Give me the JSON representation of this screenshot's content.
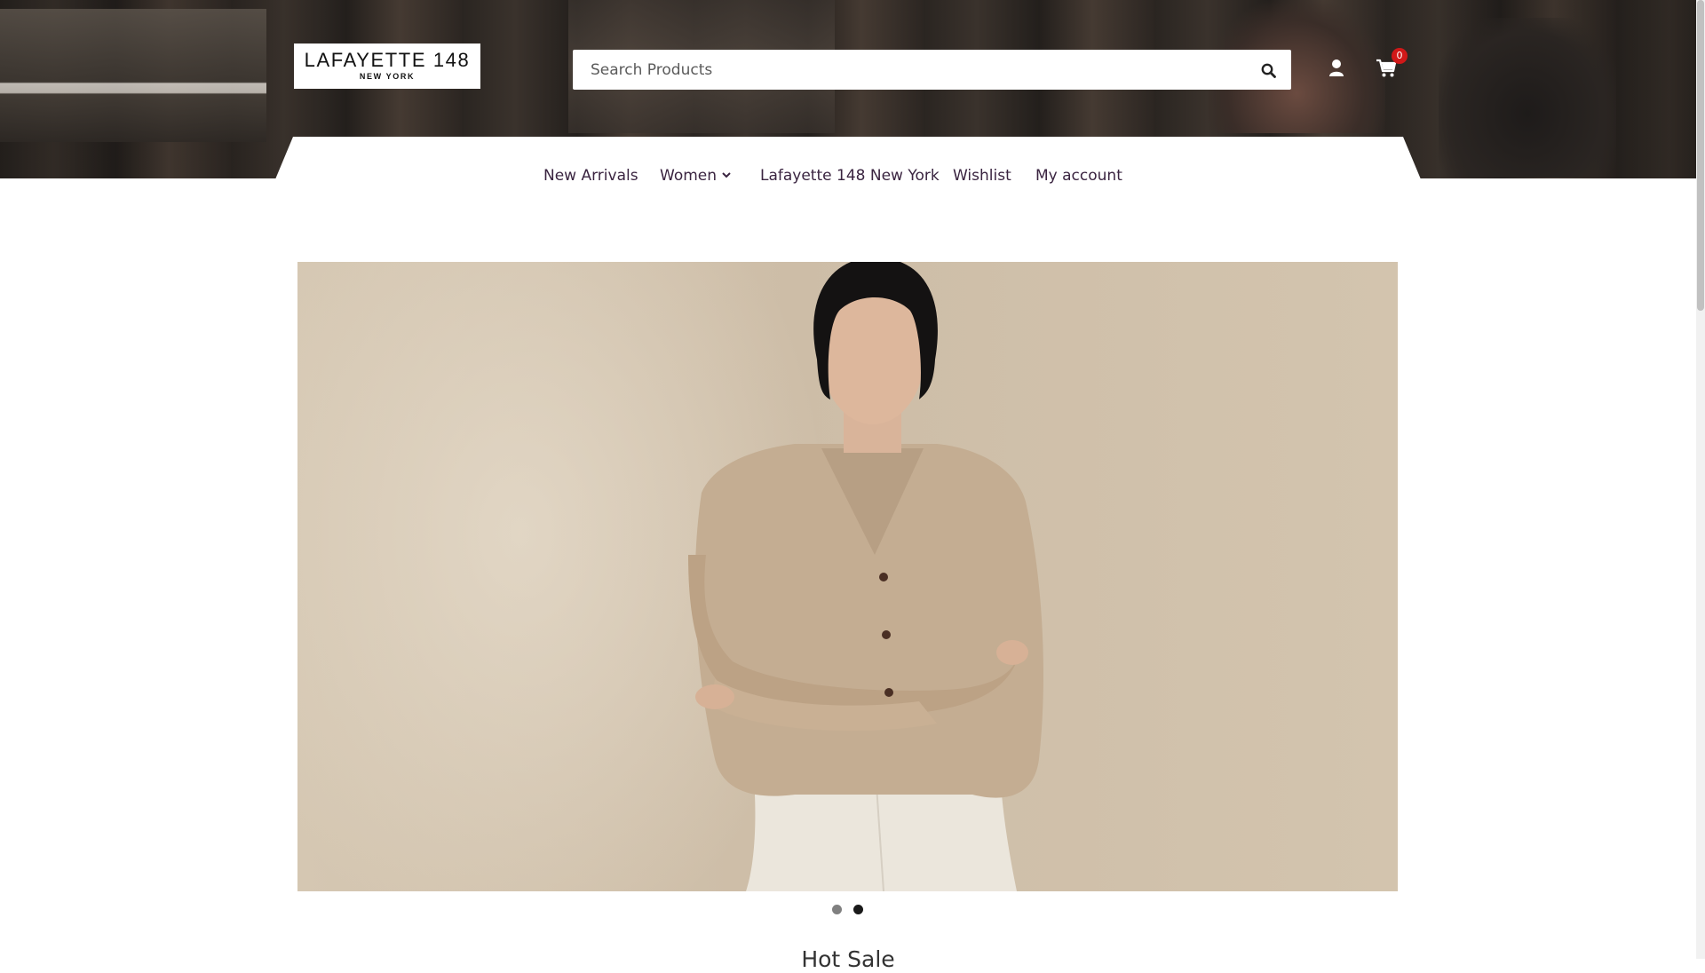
{
  "brand": {
    "logo_main": "LAFAYETTE 148",
    "logo_sub": "NEW YORK"
  },
  "search": {
    "placeholder": "Search Products",
    "button_icon": "search-icon"
  },
  "header_icons": {
    "account_icon": "user-icon",
    "cart_icon": "shopping-cart-icon",
    "cart_count": "0"
  },
  "nav": {
    "items": [
      {
        "label": "New Arrivals"
      },
      {
        "label": "Women",
        "has_dropdown": true
      },
      {
        "label": "Lafayette 148 New York"
      },
      {
        "label": "Wishlist"
      },
      {
        "label": "My account"
      }
    ]
  },
  "hero": {
    "slide_count": 2,
    "active_slide": 2
  },
  "sections": {
    "hot_sale_title": "Hot Sale"
  },
  "colors": {
    "nav_text": "#3a2440",
    "badge": "#d01818",
    "hero_bg": "#d3c4ae"
  }
}
